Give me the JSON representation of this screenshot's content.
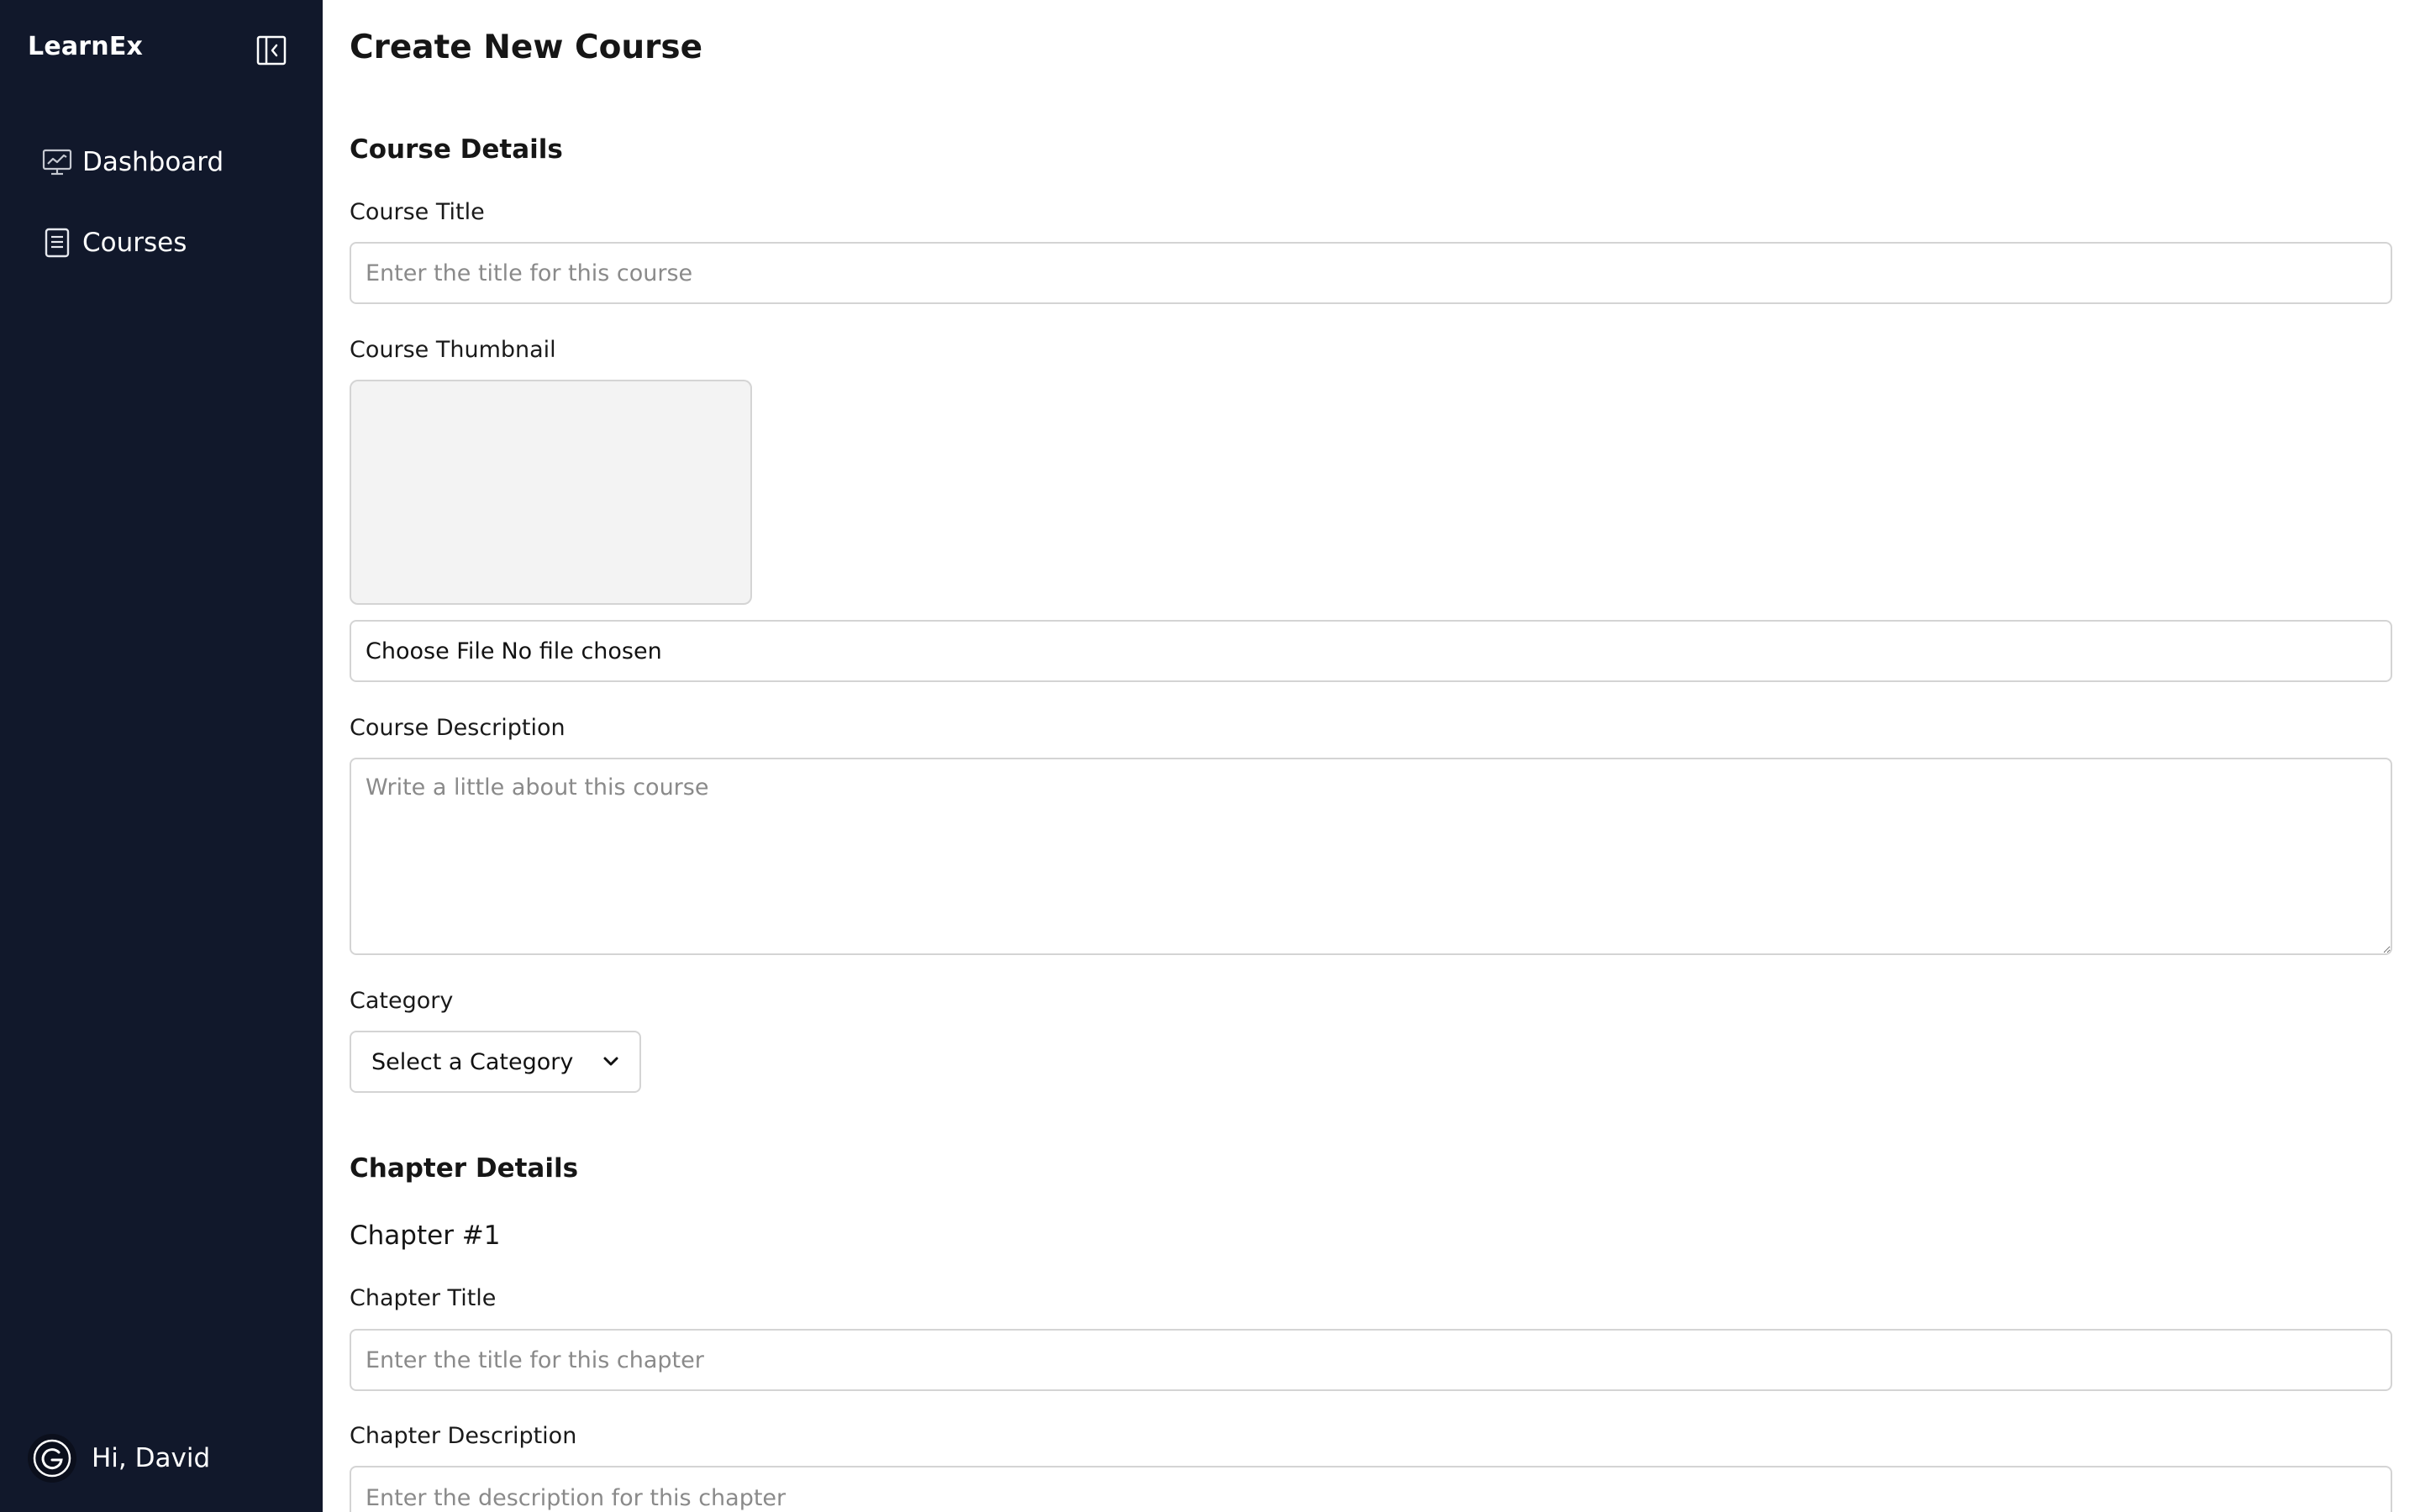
{
  "sidebar": {
    "brand": "LearnEx",
    "items": [
      {
        "label": "Dashboard",
        "icon": "dashboard-chart-icon"
      },
      {
        "label": "Courses",
        "icon": "document-icon"
      }
    ],
    "user_greeting": "Hi, David",
    "colors": {
      "background": "#11182b",
      "text": "#ffffff"
    }
  },
  "main": {
    "title": "Create New Course",
    "course_details": {
      "heading": "Course Details",
      "title_label": "Course Title",
      "title_placeholder": "Enter the title for this course",
      "thumbnail_label": "Course Thumbnail",
      "file_button": "Choose File",
      "file_status": "No file chosen",
      "description_label": "Course Description",
      "description_placeholder": "Write a little about this course",
      "category_label": "Category",
      "category_selected": "Select a Category"
    },
    "chapter_details": {
      "heading": "Chapter Details",
      "chapter_number": "Chapter #1",
      "title_label": "Chapter Title",
      "title_placeholder": "Enter the title for this chapter",
      "description_label": "Chapter Description",
      "description_placeholder": "Enter the description for this chapter"
    }
  }
}
